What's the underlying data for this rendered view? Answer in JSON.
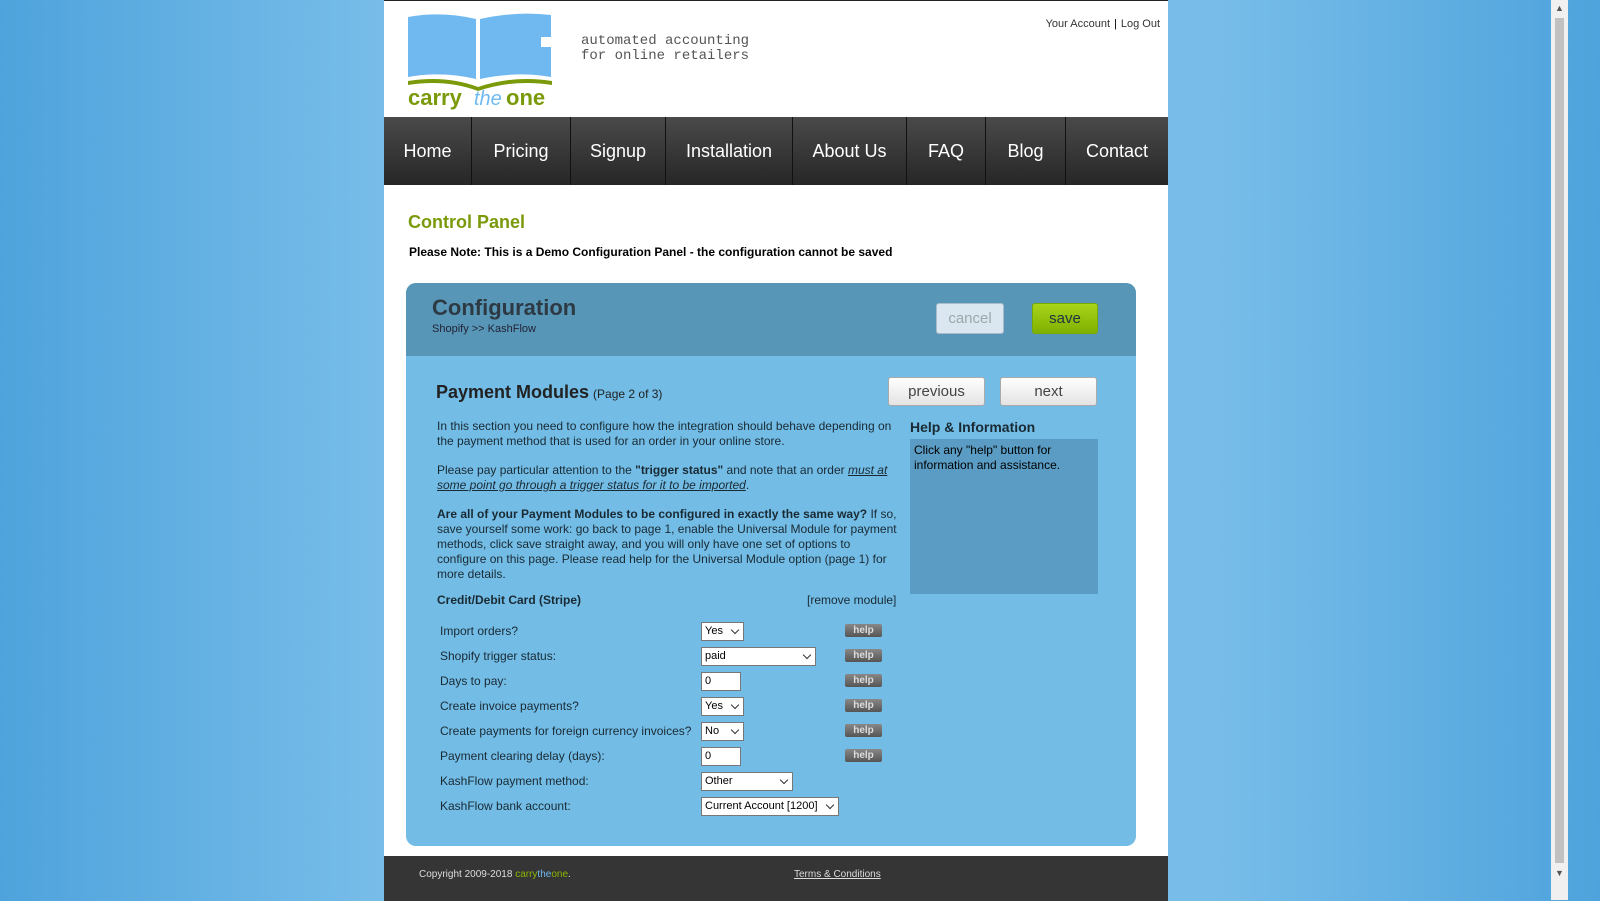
{
  "header": {
    "tagline": "automated accounting\nfor online retailers",
    "logo_text": "carry the one",
    "your_account": "Your Account",
    "separator": "|",
    "log_out": "Log Out"
  },
  "nav": [
    "Home",
    "Pricing",
    "Signup",
    "Installation",
    "About Us",
    "FAQ",
    "Blog",
    "Contact"
  ],
  "control_panel": {
    "title": "Control Panel",
    "note": "Please Note: This is a Demo Configuration Panel - the configuration cannot be saved"
  },
  "config": {
    "title": "Configuration",
    "breadcrumb": "Shopify >> KashFlow",
    "cancel": "cancel",
    "save": "save",
    "section_title": "Payment Modules",
    "page_info": "(Page 2 of 3)",
    "previous": "previous",
    "next": "next",
    "p1": "In this section you need to configure how the integration should behave depending on the payment method that is used for an order in your online store.",
    "p2a": "Please pay particular attention to the ",
    "p2b": "\"trigger status\"",
    "p2c": " and note that an order ",
    "p2d": "must at some point go through a trigger status for it to be imported",
    "p2e": ".",
    "p3a": "Are all of your Payment Modules to be configured in exactly the same way?",
    "p3b": " If so, save yourself some work: go back to page 1, enable the Universal Module for payment methods, click save straight away, and you will only have one set of options to configure on this page. Please read help for the Universal Module option (page 1) for more details.",
    "help_title": "Help & Information",
    "help_text": "Click any \"help\" button for information and assistance.",
    "module_title": "Credit/Debit Card (Stripe)",
    "remove": "[remove module]",
    "help_label": "help",
    "rows": [
      {
        "label": "Import orders?",
        "value": "Yes"
      },
      {
        "label": "Shopify trigger status:",
        "value": "paid"
      },
      {
        "label": "Days to pay:",
        "value": "0"
      },
      {
        "label": "Create invoice payments?",
        "value": "Yes"
      },
      {
        "label": "Create payments for foreign currency invoices?",
        "value": "No"
      },
      {
        "label": "Payment clearing delay (days):",
        "value": "0"
      },
      {
        "label": "KashFlow payment method:",
        "value": "Other"
      },
      {
        "label": "KashFlow bank account:",
        "value": "Current Account [1200]"
      }
    ]
  },
  "footer": {
    "copyright": "Copyright 2009-2018 ",
    "brand1": "carry",
    "brand2": "the",
    "brand3": "one",
    "dot": ".",
    "terms": "Terms & Conditions"
  },
  "colors": {
    "green": "#7a9a0a",
    "light_blue": "#72bce6",
    "dark_blue": "#5896b8"
  }
}
